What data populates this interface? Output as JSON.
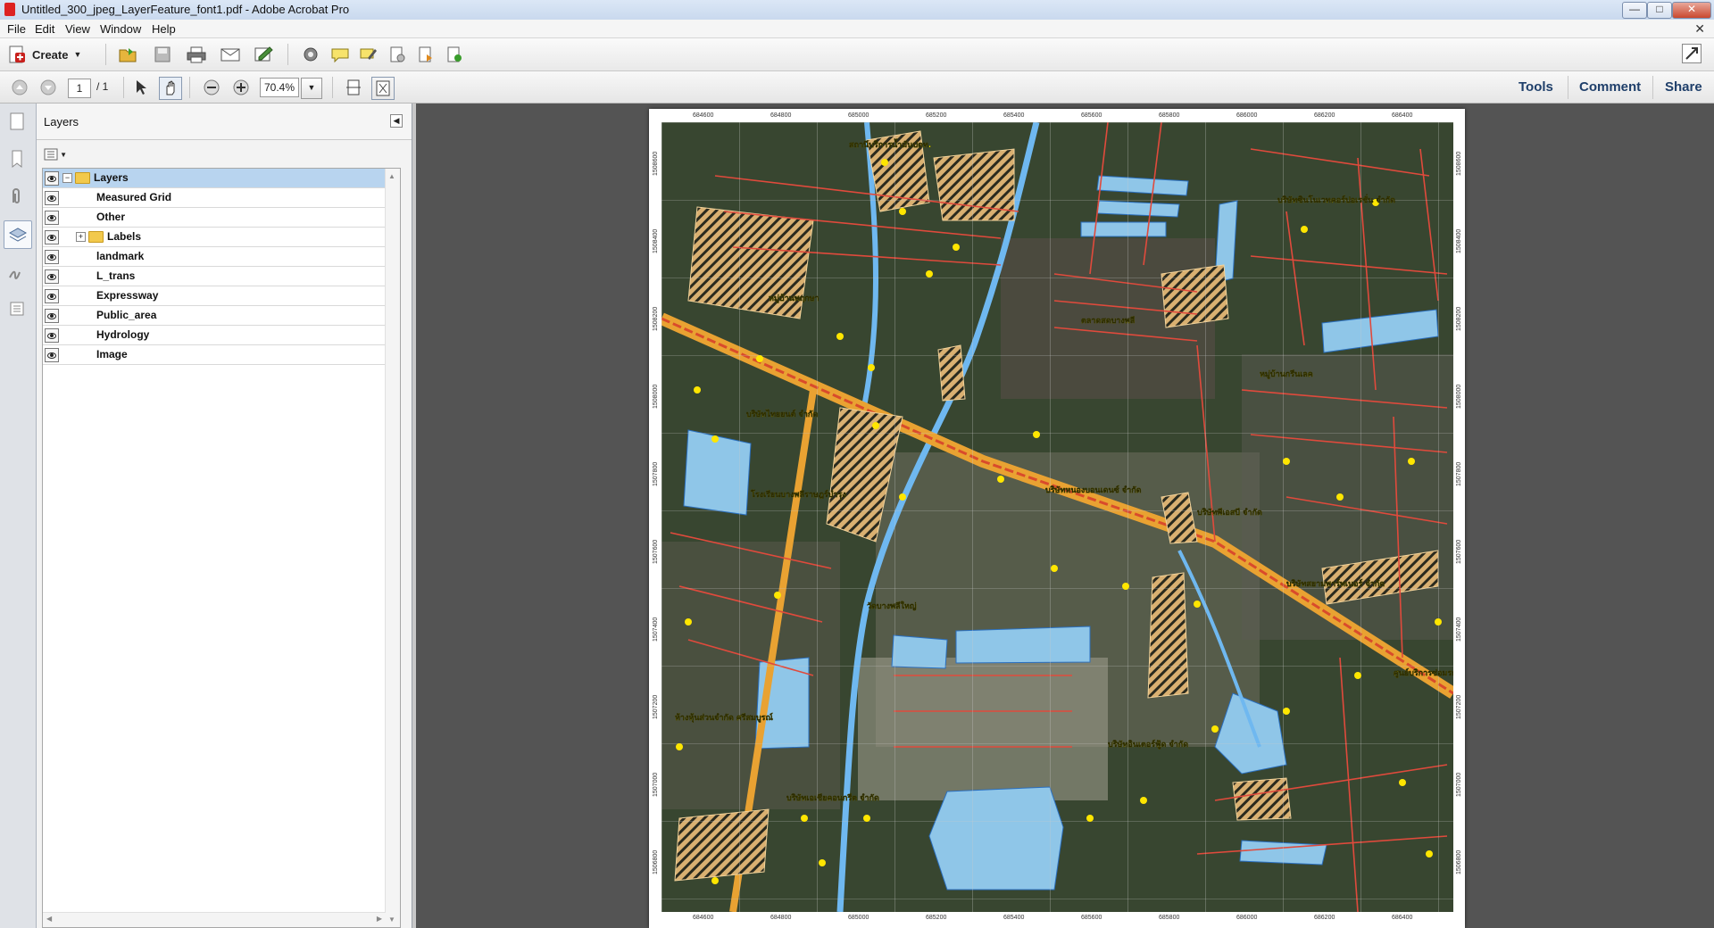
{
  "window": {
    "title": "Untitled_300_jpeg_LayerFeature_font1.pdf - Adobe Acrobat Pro",
    "controls": [
      "minimize-icon",
      "maximize-icon",
      "close-icon"
    ]
  },
  "menu": [
    "File",
    "Edit",
    "View",
    "Window",
    "Help"
  ],
  "toolbar": {
    "create_label": "Create",
    "icons": [
      "open-icon",
      "save-icon",
      "print-icon",
      "email-icon",
      "sign-icon",
      "settings-icon",
      "comment-icon",
      "highlight-icon",
      "stamp-icon",
      "attach-icon",
      "share-icon"
    ]
  },
  "navigation": {
    "page_current": "1",
    "page_total": "/ 1",
    "zoom": "70.4%"
  },
  "right_links": {
    "tools": "Tools",
    "comment": "Comment",
    "share": "Share"
  },
  "layers_panel": {
    "title": "Layers",
    "items": [
      {
        "label": "Layers",
        "folder": true,
        "expander": "−",
        "selected": true
      },
      {
        "label": "Measured Grid"
      },
      {
        "label": "Other"
      },
      {
        "label": "Labels",
        "folder": true,
        "expander": "+"
      },
      {
        "label": "landmark"
      },
      {
        "label": "L_trans"
      },
      {
        "label": "Expressway"
      },
      {
        "label": "Public_area"
      },
      {
        "label": "Hydrology"
      },
      {
        "label": "Image"
      }
    ]
  },
  "map": {
    "x_coords": [
      "684600",
      "684800",
      "685000",
      "685200",
      "685400",
      "685600",
      "685800",
      "686000",
      "686200",
      "686400"
    ],
    "y_coords": [
      "1508600",
      "1508400",
      "1508200",
      "1508000",
      "1507800",
      "1507600",
      "1507400",
      "1507200",
      "1507000",
      "1506800"
    ],
    "labels": [
      "สถานีบริการน้ำมันปตท.",
      "บริษัทซินโนเวทคอร์ปอเรชั่น จำกัด",
      "หมู่บ้านกรีนเลค",
      "บริษัทพีเอสบี จำกัด",
      "ตลาดสดบางพลี",
      "บริษัทหนองบอนเดนซ์ จำกัด",
      "บริษัทสยามพาร์ทเนอร์ จำกัด",
      "ศูนย์บริการซ่อมรถยนต์",
      "หมู่บ้านพฤกษา",
      "บริษัทไทยยนต์ จำกัด",
      "วัดบางพลีใหญ่",
      "โรงเรียนบางพลีราษฎร์บำรุง",
      "บริษัทเอเชียคอนกรีต จำกัด",
      "ห้างหุ้นส่วนจำกัด ศรีสมบูรณ์",
      "บริษัทอินเตอร์ฟู้ด จำกัด"
    ]
  }
}
